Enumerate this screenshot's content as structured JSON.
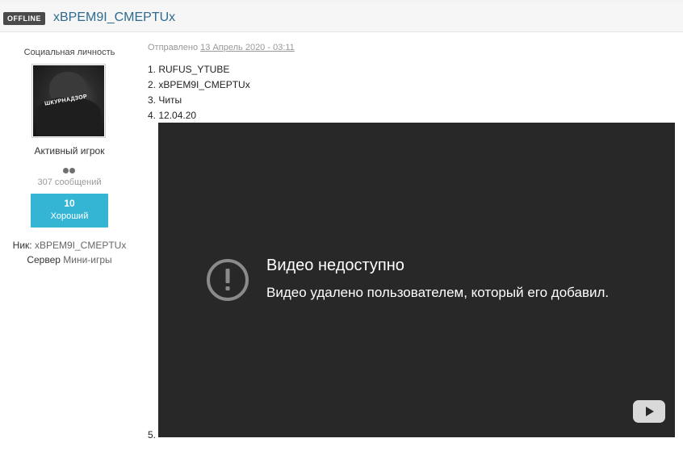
{
  "header": {
    "status_badge": "OFFLINE",
    "username": "xВРЕМ9I_CMEPTUx"
  },
  "sidebar": {
    "user_title": "Социальная личность",
    "avatar_text": "ШКУРНАДЗОР",
    "rank": "Активный игрок",
    "pip_count": 2,
    "posts": "307 сообщений",
    "reputation": {
      "value": "10",
      "label": "Хороший",
      "color": "#34b5d3"
    },
    "nick_label": "Ник:",
    "nick_value": "xВРЕМ9I_CMEPTUx",
    "server_label": "Сервер",
    "server_value": "Мини-игры"
  },
  "post": {
    "posted_prefix": "Отправлено",
    "posted_date": "13 Апрель 2020 - 03:11",
    "items": [
      "1. RUFUS_YTUBE",
      "2. xВРЕМ9I_CMEPTUx",
      "3. Читы",
      "4. 12.04.20"
    ],
    "item5": "5."
  },
  "video": {
    "title": "Видео недоступно",
    "message": "Видео удалено пользователем, который его добавил.",
    "icons": [
      "warning-icon",
      "youtube-icon"
    ]
  }
}
